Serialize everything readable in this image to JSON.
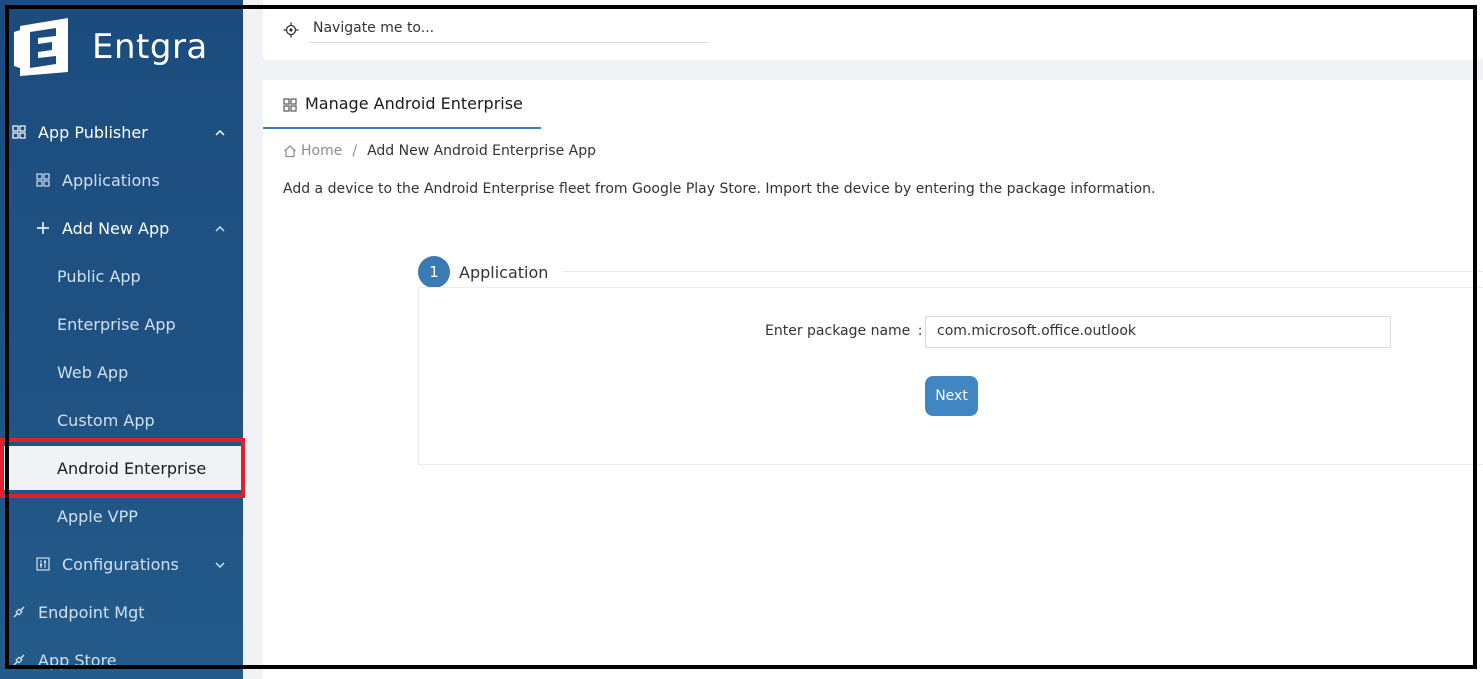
{
  "brand": {
    "name": "Entgra"
  },
  "sidebar": {
    "items": [
      {
        "label": "App Publisher",
        "icon": "grid-icon",
        "chevron": "up"
      },
      {
        "label": "Applications",
        "icon": "grid-icon"
      },
      {
        "label": "Add New App",
        "icon": "plus-icon",
        "chevron": "up"
      },
      {
        "label": "Public App"
      },
      {
        "label": "Enterprise App"
      },
      {
        "label": "Web App"
      },
      {
        "label": "Custom App"
      },
      {
        "label": "Android Enterprise",
        "active": true
      },
      {
        "label": "Apple VPP"
      },
      {
        "label": "Configurations",
        "icon": "sliders-icon",
        "chevron": "down"
      },
      {
        "label": "Endpoint Mgt",
        "icon": "link-icon"
      },
      {
        "label": "App Store",
        "icon": "link-icon"
      }
    ]
  },
  "topbar": {
    "search_placeholder": "Navigate me to..."
  },
  "page": {
    "tab_title": "Manage Android Enterprise",
    "breadcrumb": {
      "home": "Home",
      "separator": "/",
      "current": "Add New Android Enterprise App"
    },
    "description": "Add a device to the Android Enterprise fleet from Google Play Store. Import the device by entering the package information.",
    "step": {
      "number": "1",
      "title": "Application"
    },
    "form": {
      "label": "Enter package name",
      "colon": ":",
      "value": "com.microsoft.office.outlook",
      "next_label": "Next"
    }
  },
  "colors": {
    "accent": "#3a7bb5",
    "sidebar": "#1f5283",
    "highlight": "#e0202b"
  }
}
